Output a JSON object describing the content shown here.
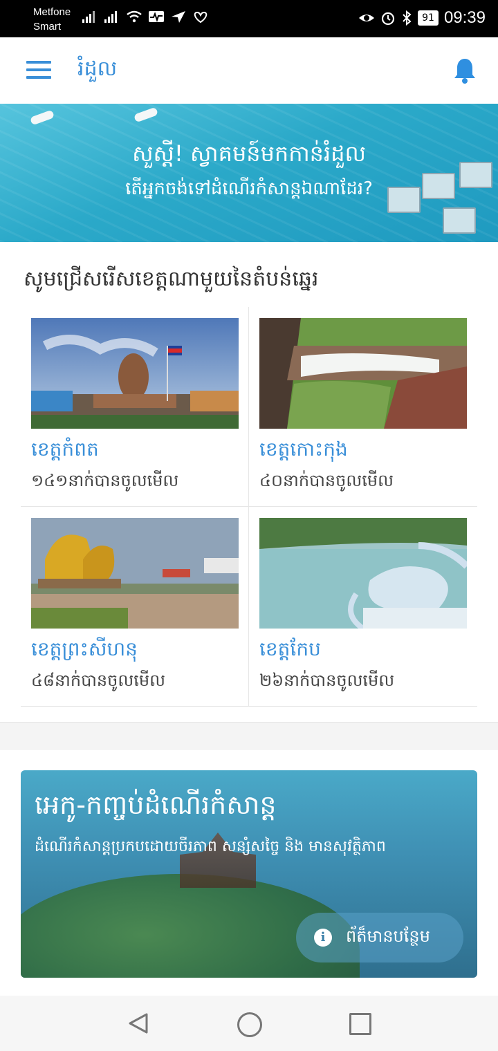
{
  "status_bar": {
    "carrier_line1": "Metfone",
    "carrier_line2": "Smart",
    "battery": "91",
    "time": "09:39",
    "icons": [
      "signal-icon",
      "signal-icon",
      "wifi-icon",
      "activity-icon",
      "location-arrow-icon",
      "heart-icon",
      "eye-icon",
      "alarm-icon",
      "bluetooth-icon",
      "battery-icon"
    ]
  },
  "app_bar": {
    "title": "រំដួល",
    "accent_color": "#3a8fd8",
    "menu_icon": "hamburger-menu-icon",
    "notification_icon": "bell-icon"
  },
  "hero": {
    "line1": "សួស្តី! ស្វាគមន៍មកកាន់រំដួល",
    "line2": "តើអ្នកចង់ទៅដំណើរកំសាន្តឯណាដែរ?"
  },
  "provinces": {
    "title": "សូមជ្រើសរើសខេត្តណាមួយនៃតំបន់ឆ្នេរ",
    "items": [
      {
        "name": "ខេត្តកំពត",
        "views": "១៤១នាក់បានចូលមើល"
      },
      {
        "name": "ខេត្តកោះកុង",
        "views": "៤០នាក់បានចូលមើល"
      },
      {
        "name": "ខេត្តព្រះសីហនុ",
        "views": "៤៨នាក់បានចូលមើល"
      },
      {
        "name": "ខេត្តកែប",
        "views": "២៦នាក់បានចូលមើល"
      }
    ]
  },
  "eco_card": {
    "title": "អេកូ-កញ្ចប់ដំណើរកំសាន្ត",
    "subtitle": "ដំណើរកំសាន្តប្រកបដោយចីរភាព សន្សំសច្ចៃ និង មានសុវត្ថិភាព",
    "button_label": "ព័ត៏មានបន្ថែម",
    "button_icon": "info-icon"
  },
  "nav_bar": {
    "icons": [
      "back-icon",
      "home-icon",
      "recent-apps-icon"
    ]
  }
}
